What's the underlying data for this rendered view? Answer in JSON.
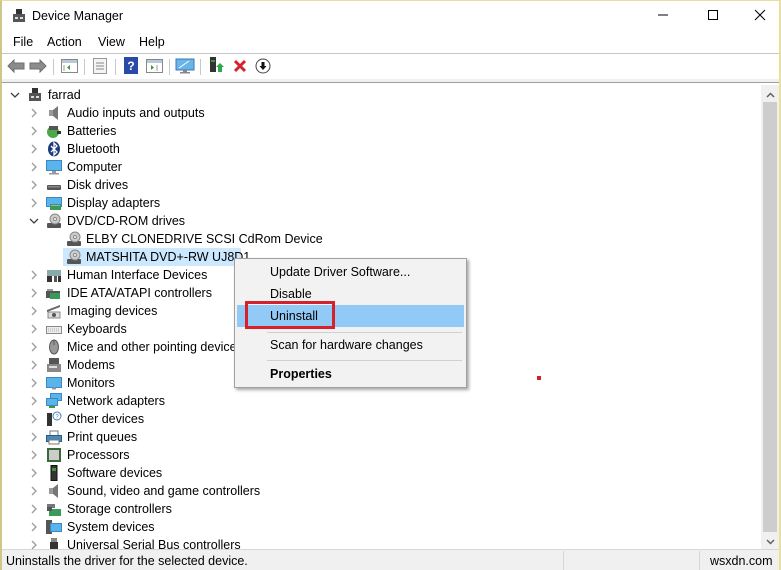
{
  "window": {
    "title": "Device Manager",
    "controls": {
      "minimize": "minimize",
      "maximize": "maximize",
      "close": "close"
    }
  },
  "menubar": {
    "items": [
      "File",
      "Action",
      "View",
      "Help"
    ]
  },
  "toolbar": {
    "buttons": [
      {
        "name": "back",
        "icon": "back-arrow-icon"
      },
      {
        "name": "forward",
        "icon": "forward-arrow-icon"
      },
      {
        "name": "show-hide-console-tree",
        "icon": "console-tree-icon"
      },
      {
        "name": "properties",
        "icon": "properties-icon"
      },
      {
        "name": "help",
        "icon": "help-icon"
      },
      {
        "name": "show-action-pane",
        "icon": "action-pane-icon"
      },
      {
        "name": "scan-hardware",
        "icon": "scan-monitor-icon"
      },
      {
        "name": "update-driver",
        "icon": "update-driver-icon"
      },
      {
        "name": "uninstall",
        "icon": "red-x-icon"
      },
      {
        "name": "disable",
        "icon": "down-arrow-circle-icon"
      }
    ]
  },
  "tree": {
    "root": {
      "label": "farrad",
      "expanded": true
    },
    "categories": [
      {
        "label": "Audio inputs and outputs",
        "icon": "speaker-icon",
        "expanded": false
      },
      {
        "label": "Batteries",
        "icon": "battery-icon",
        "expanded": false
      },
      {
        "label": "Bluetooth",
        "icon": "bluetooth-icon",
        "expanded": false
      },
      {
        "label": "Computer",
        "icon": "computer-icon",
        "expanded": false
      },
      {
        "label": "Disk drives",
        "icon": "disk-drive-icon",
        "expanded": false
      },
      {
        "label": "Display adapters",
        "icon": "display-adapter-icon",
        "expanded": false
      },
      {
        "label": "DVD/CD-ROM drives",
        "icon": "dvd-drive-icon",
        "expanded": true,
        "children": [
          {
            "label": "ELBY CLONEDRIVE SCSI CdRom Device",
            "icon": "dvd-drive-icon",
            "selected": false
          },
          {
            "label": "MATSHITA DVD+-RW UJ8D1",
            "icon": "dvd-drive-icon",
            "selected": true
          }
        ]
      },
      {
        "label": "Human Interface Devices",
        "icon": "hid-icon",
        "expanded": false
      },
      {
        "label": "IDE ATA/ATAPI controllers",
        "icon": "ide-controller-icon",
        "expanded": false
      },
      {
        "label": "Imaging devices",
        "icon": "camera-icon",
        "expanded": false
      },
      {
        "label": "Keyboards",
        "icon": "keyboard-icon",
        "expanded": false
      },
      {
        "label": "Mice and other pointing devices",
        "icon": "mouse-icon",
        "expanded": false
      },
      {
        "label": "Modems",
        "icon": "modem-icon",
        "expanded": false
      },
      {
        "label": "Monitors",
        "icon": "monitor-icon",
        "expanded": false
      },
      {
        "label": "Network adapters",
        "icon": "network-icon",
        "expanded": false
      },
      {
        "label": "Other devices",
        "icon": "unknown-device-icon",
        "expanded": false
      },
      {
        "label": "Print queues",
        "icon": "printer-icon",
        "expanded": false
      },
      {
        "label": "Processors",
        "icon": "processor-icon",
        "expanded": false
      },
      {
        "label": "Software devices",
        "icon": "software-device-icon",
        "expanded": false
      },
      {
        "label": "Sound, video and game controllers",
        "icon": "speaker-icon",
        "expanded": false
      },
      {
        "label": "Storage controllers",
        "icon": "storage-controller-icon",
        "expanded": false
      },
      {
        "label": "System devices",
        "icon": "system-device-icon",
        "expanded": false
      },
      {
        "label": "Universal Serial Bus controllers",
        "icon": "usb-icon",
        "expanded": false
      }
    ]
  },
  "context_menu": {
    "items": [
      {
        "label": "Update Driver Software...",
        "highlighted": false,
        "bold": false
      },
      {
        "label": "Disable",
        "highlighted": false,
        "bold": false
      },
      {
        "label": "Uninstall",
        "highlighted": true,
        "bold": false
      },
      {
        "separator": true
      },
      {
        "label": "Scan for hardware changes",
        "highlighted": false,
        "bold": false
      },
      {
        "separator": true
      },
      {
        "label": "Properties",
        "highlighted": false,
        "bold": true
      }
    ]
  },
  "annotation": {
    "highlight_color": "#d6202a",
    "target": "Uninstall"
  },
  "statusbar": {
    "text": "Uninstalls the driver for the selected device.",
    "watermark": "wsxdn.com"
  },
  "colors": {
    "selection": "#cce8ff",
    "menu_highlight": "#91c9f7",
    "callout": "#d6202a",
    "window_border": "#cfc78a"
  }
}
